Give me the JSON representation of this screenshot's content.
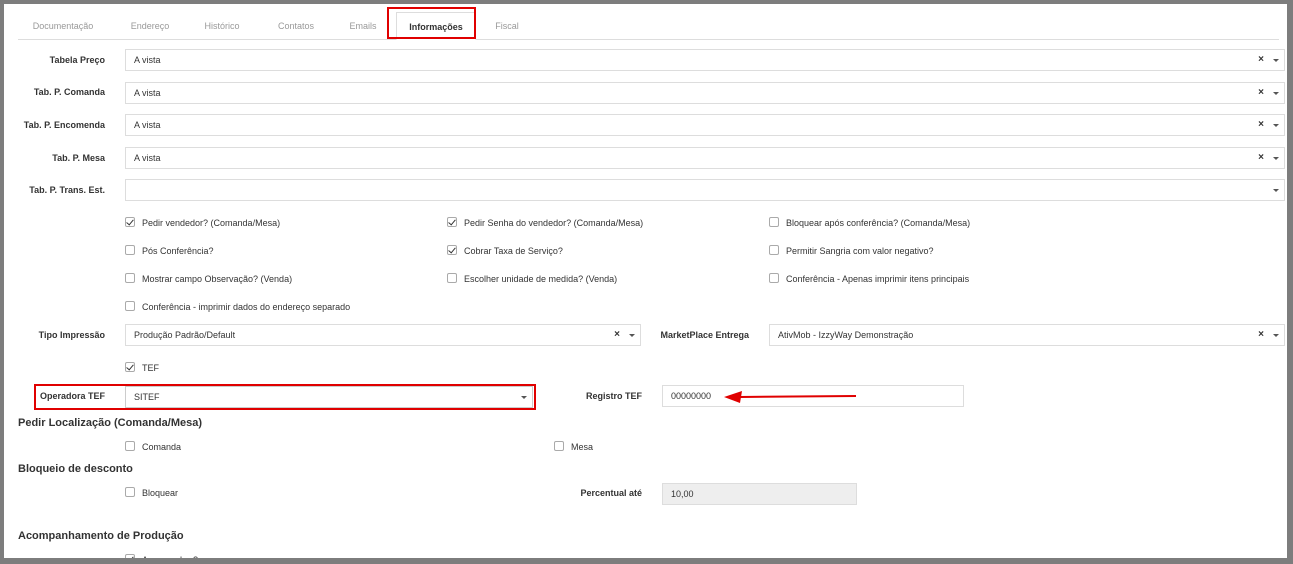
{
  "tabs": [
    "Documentação",
    "Endereço",
    "Histórico",
    "Contatos",
    "Emails",
    "Informações",
    "Fiscal"
  ],
  "fields": {
    "tabela_preco": {
      "label": "Tabela Preço",
      "value": "A vista"
    },
    "tab_p_comanda": {
      "label": "Tab. P. Comanda",
      "value": "A vista"
    },
    "tab_p_encomenda": {
      "label": "Tab. P. Encomenda",
      "value": "A vista"
    },
    "tab_p_mesa": {
      "label": "Tab. P. Mesa",
      "value": "A vista"
    },
    "tab_p_trans_est": {
      "label": "Tab. P. Trans. Est.",
      "value": ""
    },
    "tipo_impressao": {
      "label": "Tipo Impressão",
      "value": "Produção Padrão/Default"
    },
    "marketplace_entrega": {
      "label": "MarketPlace Entrega",
      "value": "AtivMob - IzzyWay Demonstração"
    },
    "operadora_tef": {
      "label": "Operadora TEF",
      "value": "SITEF"
    },
    "registro_tef": {
      "label": "Registro TEF",
      "value": "00000000"
    },
    "percentual_ate": {
      "label": "Percentual até",
      "value": "10,00"
    }
  },
  "checks": {
    "pedir_vendedor": "Pedir vendedor? (Comanda/Mesa)",
    "pedir_senha": "Pedir Senha do vendedor? (Comanda/Mesa)",
    "bloquear_apos": "Bloquear após conferência? (Comanda/Mesa)",
    "pos_conferencia": "Pós Conferência?",
    "cobrar_taxa": "Cobrar Taxa de Serviço?",
    "permitir_sangria": "Permitir Sangria com valor negativo?",
    "mostrar_obs": "Mostrar campo Observação? (Venda)",
    "escolher_unidade": "Escolher unidade de medida? (Venda)",
    "conf_apenas": "Conferência - Apenas imprimir itens principais",
    "conf_imprimir": "Conferência - imprimir dados do endereço separado",
    "tef": "TEF",
    "comanda": "Comanda",
    "mesa": "Mesa",
    "bloquear": "Bloquear",
    "acompanhar": "Acompanhar?"
  },
  "sections": {
    "pedir_localizacao": "Pedir Localização (Comanda/Mesa)",
    "bloqueio_desconto": "Bloqueio de desconto",
    "acompanhamento": "Acompanhamento de Produção"
  },
  "icons": {
    "clear": "close-icon",
    "dropdown": "chevron-down-icon",
    "annotation": "red-arrow"
  },
  "colors": {
    "highlight": "#e00000",
    "border": "#7d7d7d"
  }
}
